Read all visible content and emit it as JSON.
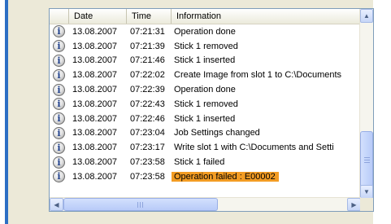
{
  "columns": [
    "Date",
    "Time",
    "Information"
  ],
  "rows": [
    {
      "icon": "info-icon",
      "date": "13.08.2007",
      "time": "07:21:31",
      "info": "Operation done"
    },
    {
      "icon": "info-icon",
      "date": "13.08.2007",
      "time": "07:21:39",
      "info": "Stick 1 removed"
    },
    {
      "icon": "info-icon",
      "date": "13.08.2007",
      "time": "07:21:46",
      "info": "Stick 1 inserted"
    },
    {
      "icon": "info-icon",
      "date": "13.08.2007",
      "time": "07:22:02",
      "info": " Create Image from slot 1 to C:\\Documents"
    },
    {
      "icon": "info-icon",
      "date": "13.08.2007",
      "time": "07:22:39",
      "info": "Operation done"
    },
    {
      "icon": "info-icon",
      "date": "13.08.2007",
      "time": "07:22:43",
      "info": "Stick 1 removed"
    },
    {
      "icon": "info-icon",
      "date": "13.08.2007",
      "time": "07:22:46",
      "info": "Stick 1 inserted"
    },
    {
      "icon": "info-icon",
      "date": "13.08.2007",
      "time": "07:23:04",
      "info": "Job Settings changed"
    },
    {
      "icon": "info-icon",
      "date": "13.08.2007",
      "time": "07:23:17",
      "info": " Write slot 1 with C:\\Documents and Setti"
    },
    {
      "icon": "info-icon",
      "date": "13.08.2007",
      "time": "07:23:58",
      "info": "Stick 1 failed"
    },
    {
      "icon": "info-icon",
      "date": "13.08.2007",
      "time": "07:23:58",
      "info": "Operation failed : E00002",
      "highlight": true
    }
  ],
  "colors": {
    "highlight": "#f39c23",
    "accent_bar": "#2d6fc4",
    "panel_border": "#7f9db9"
  }
}
